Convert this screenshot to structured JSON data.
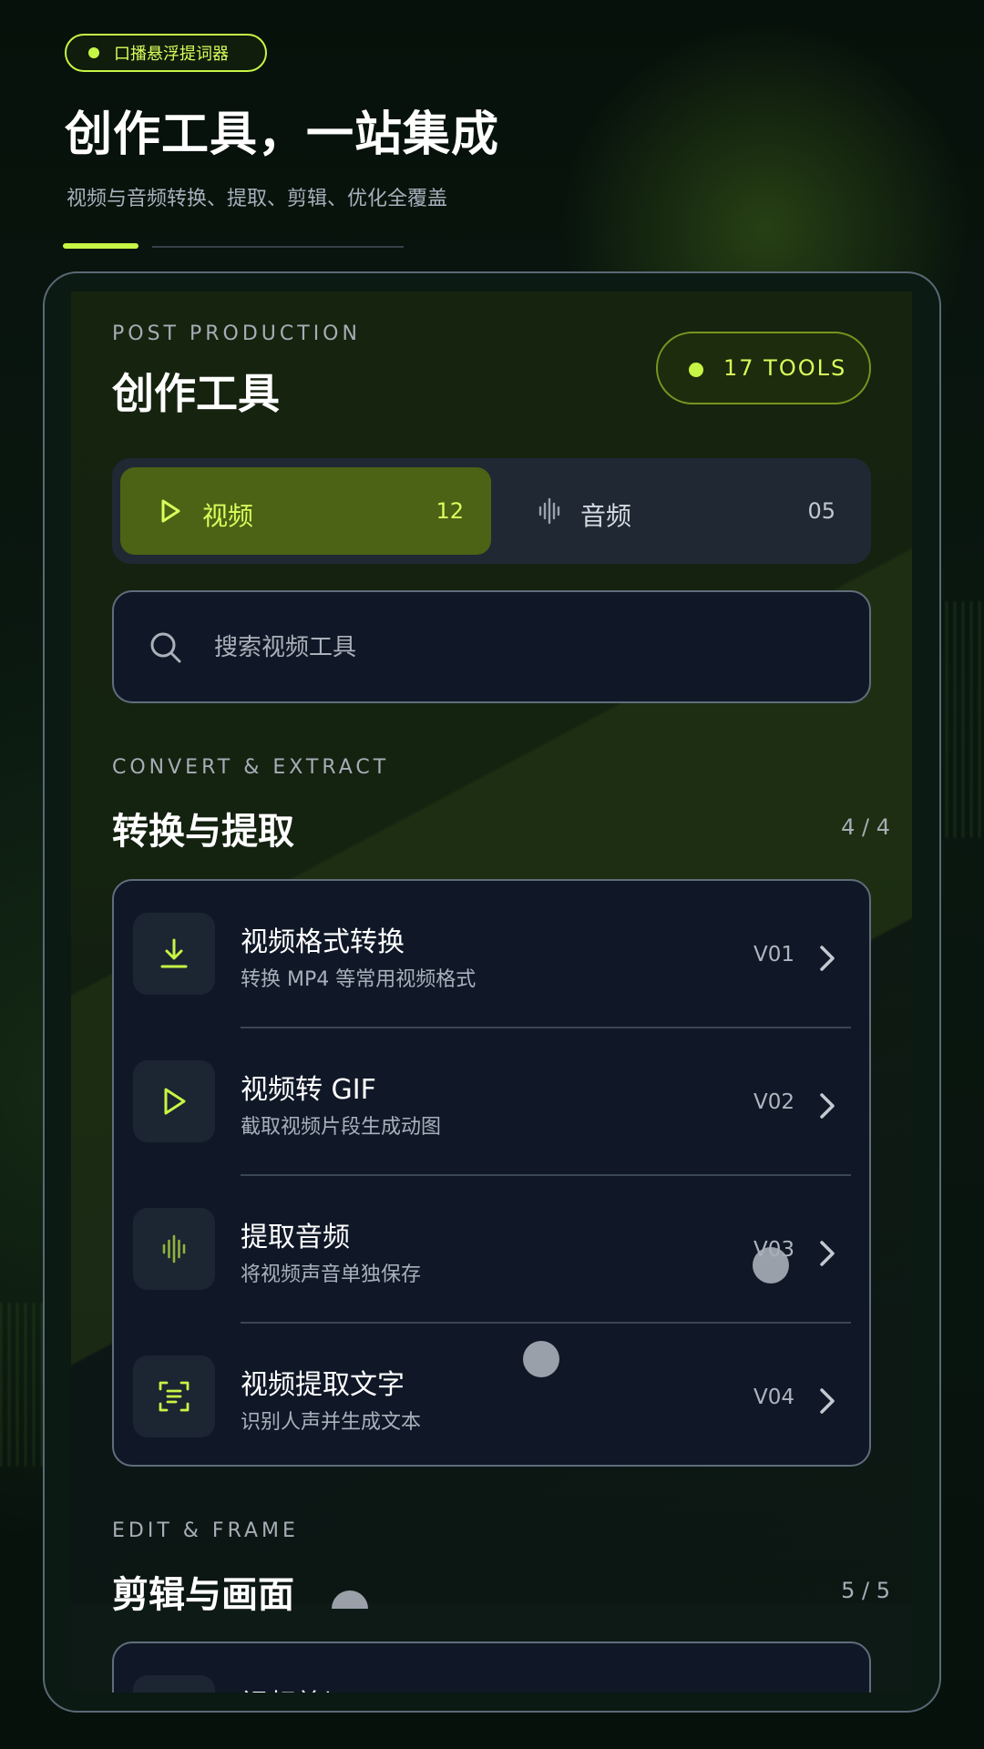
{
  "colors": {
    "accent": "#c6f545",
    "accent_text": "#d9ff5c",
    "active_tab_bg": "#4c6315",
    "card_bg": "#101827",
    "border": "#5f6d7b"
  },
  "header": {
    "tag_label": "口播悬浮提词器",
    "title": "创作工具，一站集成",
    "subtitle": "视频与音频转换、提取、剪辑、优化全覆盖"
  },
  "panel": {
    "eyebrow": "POST PRODUCTION",
    "title": "创作工具",
    "tools_badge": "17 TOOLS"
  },
  "tabs": [
    {
      "label": "视频",
      "count": "12",
      "icon": "play-icon",
      "active": true
    },
    {
      "label": "音频",
      "count": "05",
      "icon": "waveform-icon",
      "active": false
    }
  ],
  "search": {
    "placeholder": "搜索视频工具",
    "value": ""
  },
  "sections": [
    {
      "eyebrow": "CONVERT & EXTRACT",
      "title": "转换与提取",
      "count": "4 / 4",
      "items": [
        {
          "title": "视频格式转换",
          "desc": "转换 MP4 等常用视频格式",
          "version": "V01",
          "icon": "download-icon"
        },
        {
          "title": "视频转 GIF",
          "desc": "截取视频片段生成动图",
          "version": "V02",
          "icon": "play-icon"
        },
        {
          "title": "提取音频",
          "desc": "将视频声音单独保存",
          "version": "V03",
          "icon": "waveform-icon"
        },
        {
          "title": "视频提取文字",
          "desc": "识别人声并生成文本",
          "version": "V04",
          "icon": "text-scan-icon"
        }
      ]
    },
    {
      "eyebrow": "EDIT & FRAME",
      "title": "剪辑与画面",
      "count": "5 / 5",
      "items": [
        {
          "title": "视频剪切"
        }
      ]
    }
  ]
}
